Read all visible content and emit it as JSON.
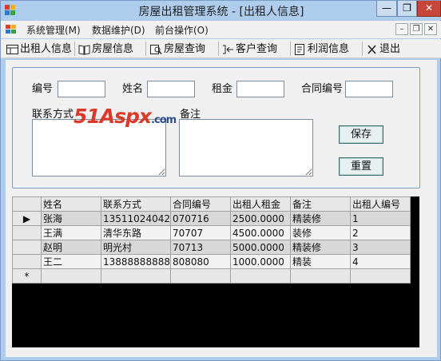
{
  "window": {
    "title": "房屋出租管理系统 - [出租人信息]",
    "min_label": "—",
    "max_label": "❐",
    "close_label": "✕"
  },
  "menu": {
    "items": [
      {
        "label": "系统管理(M)"
      },
      {
        "label": "数据维护(D)"
      },
      {
        "label": "前台操作(O)"
      }
    ],
    "mdi_min": "–",
    "mdi_restore": "❐",
    "mdi_close": "✕"
  },
  "toolbar": {
    "buttons": [
      {
        "label": "出租人信息",
        "icon": "table-icon"
      },
      {
        "label": "房屋信息",
        "icon": "book-icon"
      },
      {
        "label": "房屋查询",
        "icon": "search-icon"
      },
      {
        "label": "客户查询",
        "icon": "arrow-icon"
      },
      {
        "label": "利润信息",
        "icon": "document-icon"
      },
      {
        "label": "退出",
        "icon": "close-icon"
      }
    ]
  },
  "form": {
    "id_label": "编号",
    "name_label": "姓名",
    "rent_label": "租金",
    "contract_label": "合同编号",
    "contact_label": "联系方式",
    "remark_label": "备注",
    "id_value": "",
    "name_value": "",
    "rent_value": "",
    "contract_value": "",
    "contact_value": "",
    "remark_value": "",
    "save_label": "保存",
    "reset_label": "重置"
  },
  "watermark": {
    "main": "51Aspx",
    "suffix": ".com"
  },
  "grid": {
    "columns": [
      "姓名",
      "联系方式",
      "合同编号",
      "出租人租金",
      "备注",
      "出租人编号"
    ],
    "rows": [
      [
        "张海",
        "13511024042",
        "070716",
        "2500.0000",
        "精装修",
        "1"
      ],
      [
        "王满",
        "清华东路",
        "70707",
        "4500.0000",
        "装修",
        "2"
      ],
      [
        "赵明",
        "明光村",
        "70713",
        "5000.0000",
        "精装修",
        "3"
      ],
      [
        "王二",
        "13888888888",
        "808080",
        "1000.0000",
        "精装",
        "4"
      ]
    ],
    "current_row_marker": "▶",
    "new_row_marker": "*"
  },
  "colors": {
    "window_bg": "#aeccec",
    "control_bg": "#f0f0f0",
    "grid_bg": "#000000",
    "close_red": "#c7463a",
    "watermark_red": "#d93a2a",
    "watermark_blue": "#2b4f8a"
  }
}
